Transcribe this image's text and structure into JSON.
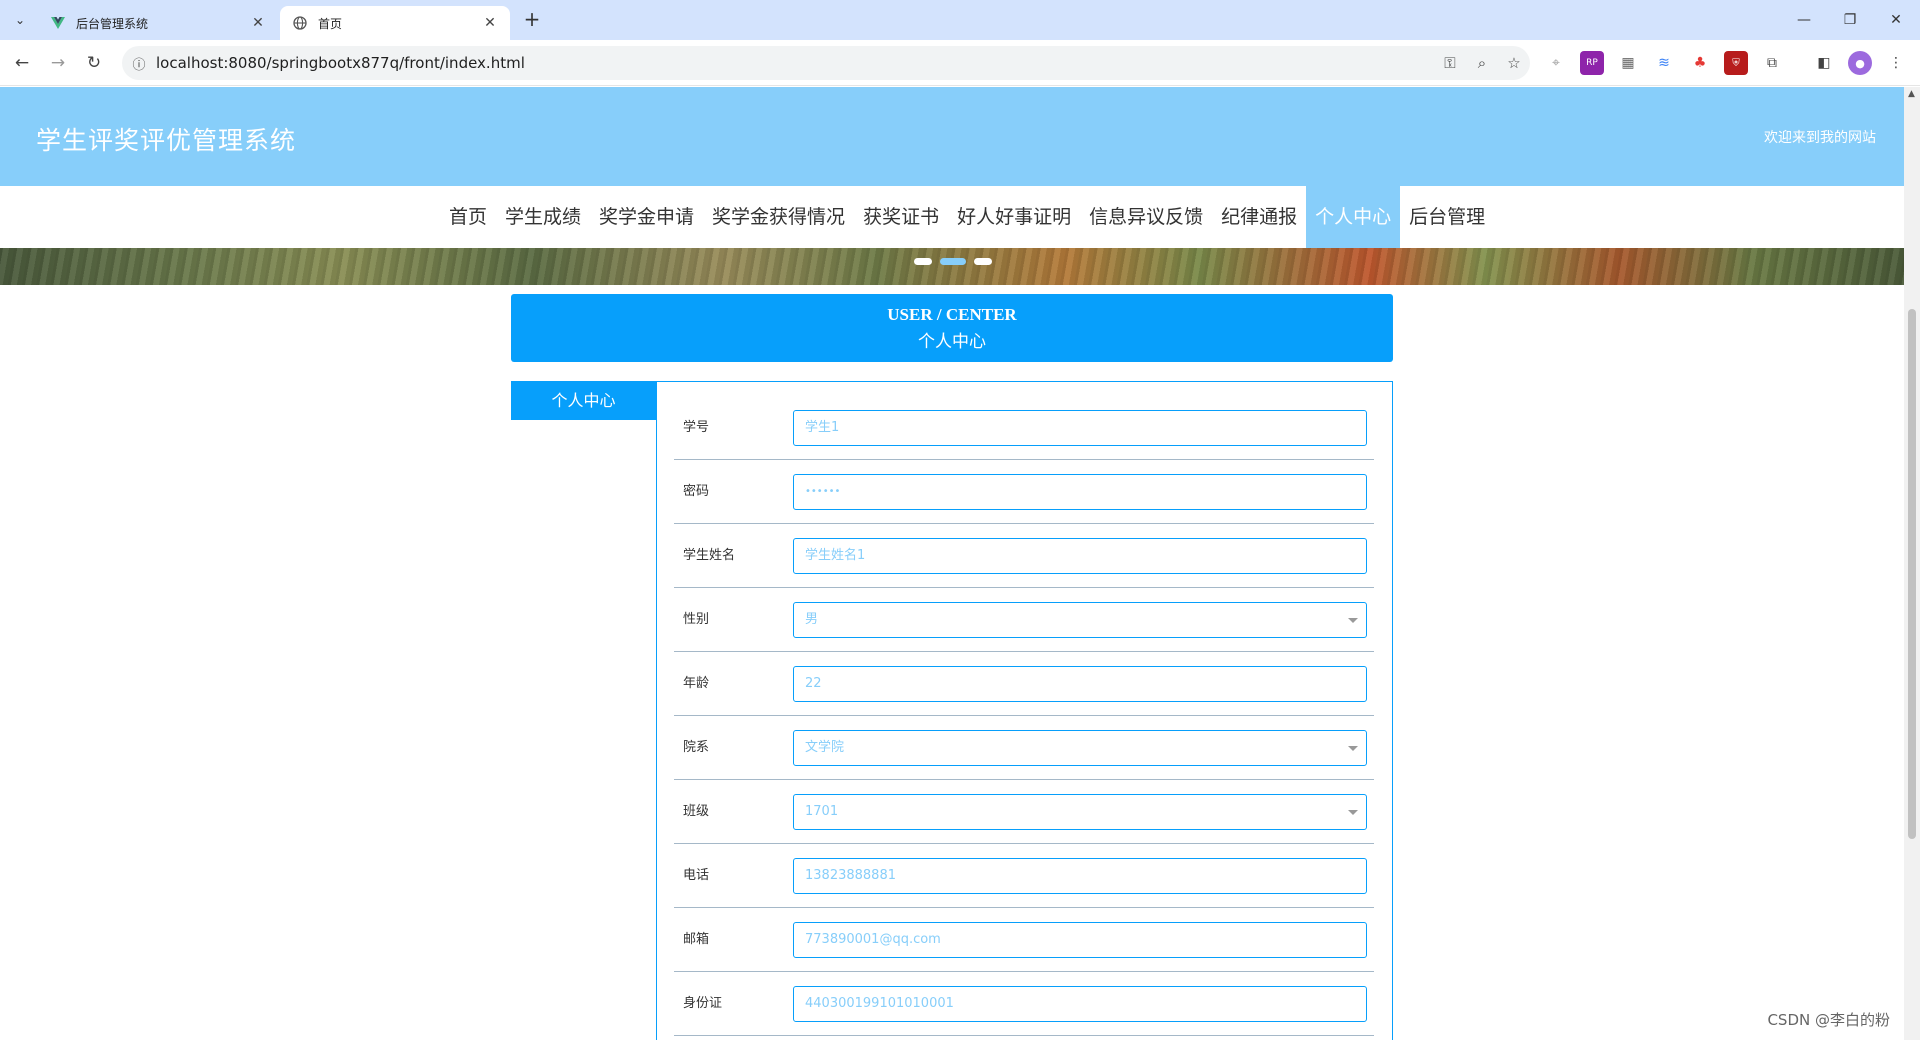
{
  "browser": {
    "tabs": [
      {
        "title": "后台管理系统",
        "icon": "vue-logo-icon"
      },
      {
        "title": "首页",
        "icon": "globe-icon"
      }
    ],
    "url": "localhost:8080/springbootx877q/front/index.html"
  },
  "header": {
    "title": "学生评奖评优管理系统",
    "welcome": "欢迎来到我的网站"
  },
  "nav": {
    "items": [
      "首页",
      "学生成绩",
      "奖学金申请",
      "奖学金获得情况",
      "获奖证书",
      "好人好事证明",
      "信息异议反馈",
      "纪律通报",
      "个人中心",
      "后台管理"
    ],
    "active": "个人中心"
  },
  "banner": {
    "slides": 3,
    "active_slide": 2
  },
  "center": {
    "title_en": "USER / CENTER",
    "title_cn": "个人中心",
    "side_tab": "个人中心"
  },
  "form": {
    "fields": [
      {
        "label": "学号",
        "value": "学生1",
        "type": "input"
      },
      {
        "label": "密码",
        "value": "••••••",
        "type": "password"
      },
      {
        "label": "学生姓名",
        "value": "学生姓名1",
        "type": "input"
      },
      {
        "label": "性别",
        "value": "男",
        "type": "select"
      },
      {
        "label": "年龄",
        "value": "22",
        "type": "input"
      },
      {
        "label": "院系",
        "value": "文学院",
        "type": "select"
      },
      {
        "label": "班级",
        "value": "1701",
        "type": "select"
      },
      {
        "label": "电话",
        "value": "13823888881",
        "type": "input"
      },
      {
        "label": "邮箱",
        "value": "773890001@qq.com",
        "type": "input"
      },
      {
        "label": "身份证",
        "value": "440300199101010001",
        "type": "input"
      }
    ]
  },
  "watermark": "CSDN @李白的粉",
  "colors": {
    "header_bg": "#87cefa",
    "accent": "#079ffb",
    "field_text": "#87cefa"
  }
}
